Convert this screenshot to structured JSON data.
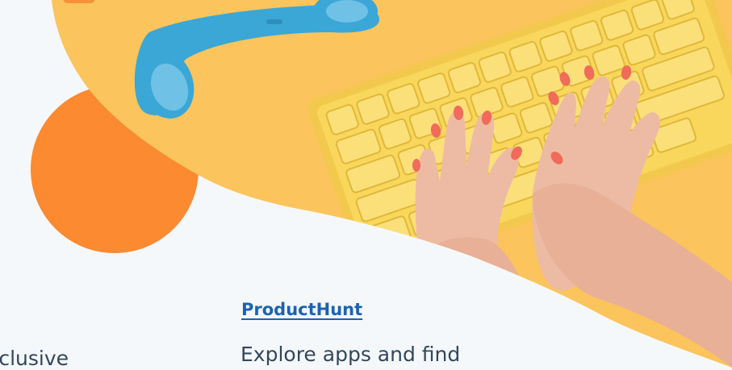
{
  "cards": [
    {
      "title": "ProductHunt",
      "description": "Explore apps and find"
    }
  ],
  "previous_card": {
    "description_fragment": "xclusive"
  },
  "colors": {
    "background": "#f5f8fb",
    "blob_yellow": "#fbc45c",
    "blob_orange": "#fb8a31",
    "keyboard_yellow": "#f8d75c",
    "phone_blue": "#3aa7d7",
    "link_blue": "#1b63b0",
    "text_dark": "#33475b"
  },
  "hero_image": {
    "icons": [
      "phone-handset-icon",
      "keyboard-icon",
      "typing-hands-icon"
    ]
  }
}
